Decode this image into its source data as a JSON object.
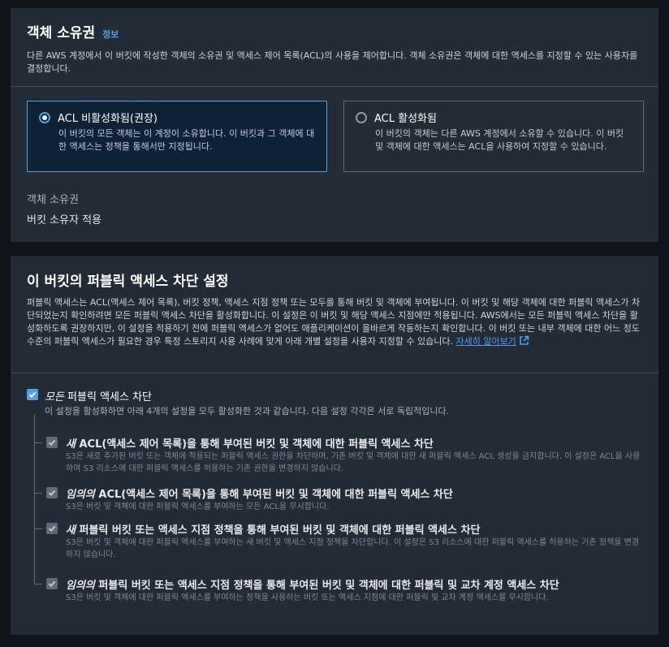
{
  "ownership": {
    "title": "객체 소유권",
    "info_link": "정보",
    "description": "다른 AWS 계정에서 이 버킷에 작성한 객체의 소유권 및 액세스 제어 목록(ACL)의 사용을 제어합니다. 객체 소유권은 객체에 대한 액세스를 지정할 수 있는 사용자를 결정합니다.",
    "options": [
      {
        "label": "ACL 비활성화됨(권장)",
        "description": "이 버킷의 모든 객체는 이 계정이 소유합니다. 이 버킷과 그 객체에 대한 액세스는 정책을 통해서만 지정됩니다.",
        "selected": true
      },
      {
        "label": "ACL 활성화됨",
        "description": "이 버킷의 객체는 다른 AWS 계정에서 소유할 수 있습니다. 이 버킷 및 객체에 대한 액세스는 ACL을 사용하여 지정할 수 있습니다.",
        "selected": false
      }
    ],
    "owner_label": "객체 소유권",
    "owner_value": "버킷 소유자 적용"
  },
  "bpa": {
    "title": "이 버킷의 퍼블릭 액세스 차단 설정",
    "description": "퍼블릭 액세스는 ACL(액세스 제어 목록), 버킷 정책, 액세스 지점 정책 또는 모두를 통해 버킷 및 객체에 부여됩니다. 이 버킷 및 해당 객체에 대한 퍼블릭 액세스가 차단되었는지 확인하려면 모든 퍼블릭 액세스 차단을 활성화합니다. 이 설정은 이 버킷 및 해당 액세스 지점에만 적용됩니다. AWS에서는 모든 퍼블릭 액세스 차단을 활성화하도록 권장하지만, 이 설정을 적용하기 전에 퍼블릭 액세스가 없어도 애플리케이션이 올바르게 작동하는지 확인합니다. 이 버킷 또는 내부 객체에 대한 어느 정도 수준의 퍼블릭 액세스가 필요한 경우 특정 스토리지 사용 사례에 맞게 아래 개별 설정을 사용자 지정할 수 있습니다.",
    "learn_more": "자세히 알아보기",
    "block_all": {
      "title_emph": "모든",
      "title_rest": " 퍼블릭 액세스 차단",
      "description": "이 설정을 활성화하면 아래 4개의 설정을 모두 활성화한 것과 같습니다. 다음 설정 각각은 서로 독립적입니다.",
      "checked": true
    },
    "settings": [
      {
        "title_emph": "새",
        "title_rest": " ACL(액세스 제어 목록)을 통해 부여된 버킷 및 객체에 대한 퍼블릭 액세스 차단",
        "description": "S3은 새로 추가된 버킷 또는 객체에 적용되는 퍼블릭 액세스 권한을 차단하며, 기존 버킷 및 객체에 대한 새 퍼블릭 액세스 ACL 생성을 금지합니다. 이 설정은 ACL을 사용하여 S3 리소스에 대한 퍼블릭 액세스를 허용하는 기존 권한을 변경하지 않습니다.",
        "checked": true
      },
      {
        "title_emph": "임의의",
        "title_rest": " ACL(액세스 제어 목록)을 통해 부여된 버킷 및 객체에 대한 퍼블릭 액세스 차단",
        "description": "S3은 버킷 및 객체에 대한 퍼블릭 액세스를 부여하는 모든 ACL을 무시합니다.",
        "checked": true
      },
      {
        "title_emph": "새",
        "title_rest": " 퍼블릭 버킷 또는 액세스 지점 정책을 통해 부여된 버킷 및 객체에 대한 퍼블릭 액세스 차단",
        "description": "S3은 버킷 및 객체에 대한 퍼블릭 액세스를 부여하는 새 버킷 및 액세스 지점 정책을 차단합니다. 이 설정은 S3 리소스에 대한 퍼블릭 액세스를 허용하는 기존 정책을 변경하지 않습니다.",
        "checked": true
      },
      {
        "title_emph": "임의의",
        "title_rest": " 퍼블릭 버킷 또는 액세스 지점 정책을 통해 부여된 버킷 및 객체에 대한 퍼블릭 및 교차 계정 액세스 차단",
        "description": "S3은 버킷 및 객체에 대한 퍼블릭 액세스를 부여하는 정책을 사용하는 버킷 또는 액세스 지점에 대한 퍼블릭 및 교차 계정 액세스를 무시합니다.",
        "checked": true
      }
    ]
  },
  "icons": {
    "external": "external-link-icon",
    "check": "check-icon"
  },
  "colors": {
    "accent": "#539fe5",
    "panel": "#232b37",
    "page": "#0f141a"
  }
}
